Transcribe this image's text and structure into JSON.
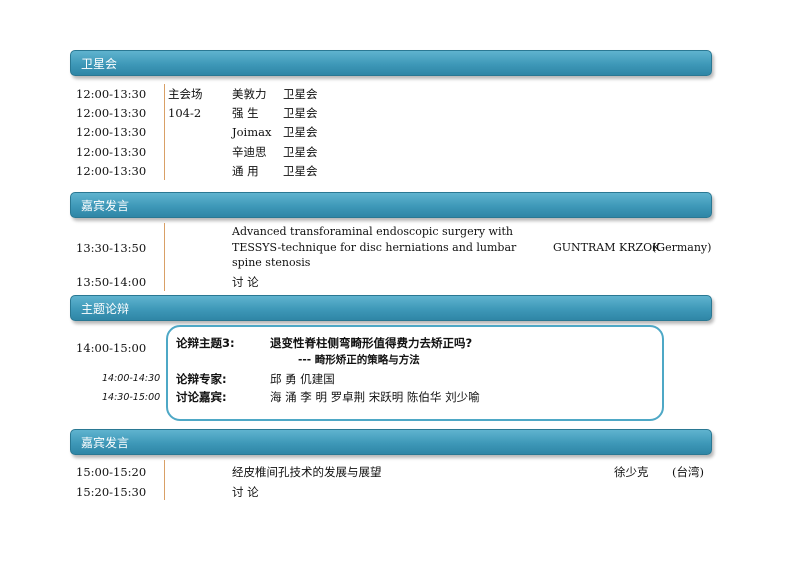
{
  "sections": {
    "satellite": "卫星会",
    "guest1": "嘉宾发言",
    "debate": "主题论辩",
    "guest2": "嘉宾发言"
  },
  "satellite_rows": [
    {
      "time": "12:00-13:30",
      "venue": "主会场",
      "company": "美敦力",
      "type": "卫星会"
    },
    {
      "time": "12:00-13:30",
      "venue": "104-2",
      "company": "强 生",
      "type": "卫星会"
    },
    {
      "time": "12:00-13:30",
      "venue": "",
      "company": "Joimax",
      "type": "卫星会"
    },
    {
      "time": "12:00-13:30",
      "venue": "",
      "company": "辛迪思",
      "type": "卫星会"
    },
    {
      "time": "12:00-13:30",
      "venue": "",
      "company": "通 用",
      "type": "卫星会"
    }
  ],
  "guest1_rows": [
    {
      "time": "13:30-13:50",
      "title_lines": [
        "Advanced transforaminal endoscopic surgery with",
        "TESSYS-technique for disc herniations and lumbar",
        "spine stenosis"
      ],
      "speaker": "GUNTRAM KRZOK",
      "origin": "(Germany)"
    },
    {
      "time": "13:50-14:00",
      "topic": "讨 论"
    }
  ],
  "debate": {
    "time": "14:00-15:00",
    "topic_label": "论辩主题3:",
    "topic": "退变性脊柱侧弯畸形值得费力去矫正吗?",
    "subtopic": "--- 畸形矫正的策略与方法",
    "expert_time": "14:00-14:30",
    "expert_label": "论辩专家:",
    "experts": "邱  勇  仉建国",
    "guest_time": "14:30-15:00",
    "guest_label": "讨论嘉宾:",
    "guests": "海  涌  李  明  罗卓荆  宋跃明  陈伯华  刘少喻"
  },
  "guest2_rows": [
    {
      "time": "15:00-15:20",
      "topic": "经皮椎间孔技术的发展与展望",
      "speaker": "徐少克",
      "origin": "(台湾)"
    },
    {
      "time": "15:20-15:30",
      "topic": "讨 论"
    }
  ]
}
